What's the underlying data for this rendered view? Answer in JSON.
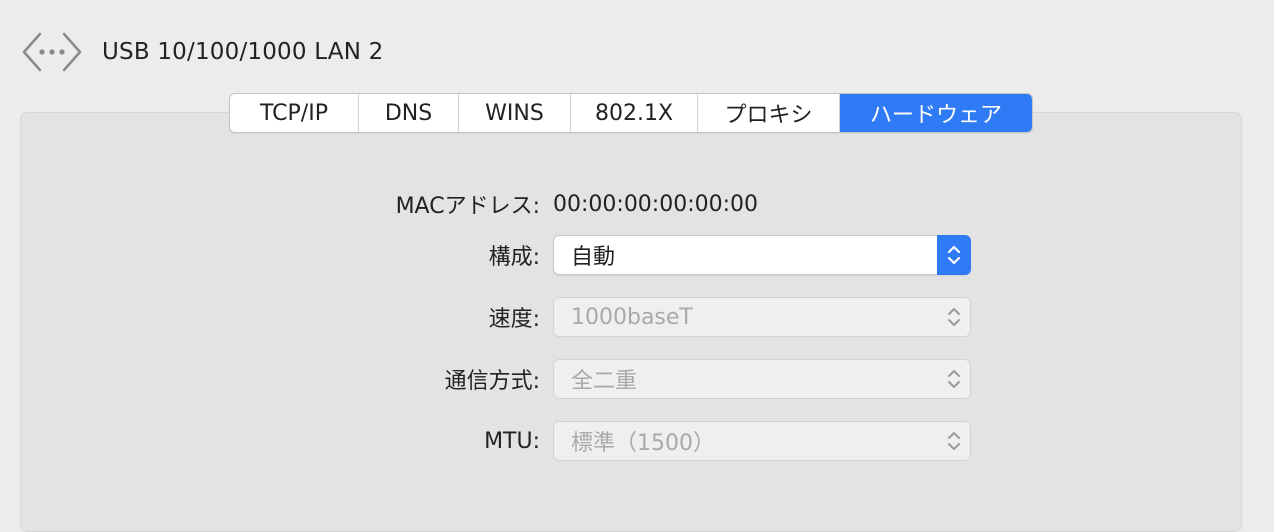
{
  "header": {
    "interface_name": "USB 10/100/1000 LAN 2",
    "icon": "network-interface-icon"
  },
  "tabs": [
    {
      "label": "TCP/IP",
      "active": false
    },
    {
      "label": "DNS",
      "active": false
    },
    {
      "label": "WINS",
      "active": false
    },
    {
      "label": "802.1X",
      "active": false
    },
    {
      "label": "プロキシ",
      "active": false
    },
    {
      "label": "ハードウェア",
      "active": true
    }
  ],
  "hardware": {
    "mac_label": "MACアドレス:",
    "mac_value": "00:00:00:00:00:00",
    "config_label": "構成:",
    "config_value": "自動",
    "speed_label": "速度:",
    "speed_value": "1000baseT",
    "duplex_label": "通信方式:",
    "duplex_value": "全二重",
    "mtu_label": "MTU:",
    "mtu_value": "標準（1500）"
  },
  "colors": {
    "accent": "#2f7bf5",
    "background": "#ececec",
    "panel": "#e3e3e3",
    "disabled_text": "#a9a9a9"
  }
}
